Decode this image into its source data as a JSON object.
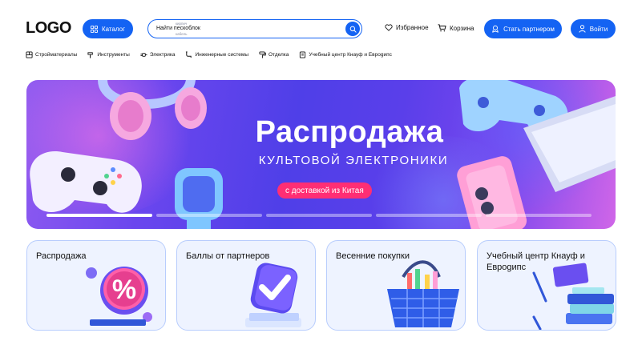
{
  "header": {
    "logo": "LOGO",
    "catalog_label": "Каталог",
    "search": {
      "value": "Найти пескоблок",
      "hint_top": "кирпич",
      "hint_bottom": "кабель"
    },
    "favorites_label": "Избранное",
    "cart_label": "Корзина",
    "partner_label": "Стать партнером",
    "login_label": "Войти"
  },
  "categories": [
    {
      "label": "Стройматериалы",
      "icon": "building-materials-icon"
    },
    {
      "label": "Инструменты",
      "icon": "hammer-icon"
    },
    {
      "label": "Электрика",
      "icon": "plug-icon"
    },
    {
      "label": "Инженерные системы",
      "icon": "pipe-icon"
    },
    {
      "label": "Отделка",
      "icon": "paint-roller-icon"
    },
    {
      "label": "Учебный центр Кнауф и Евроgипс",
      "icon": "book-icon"
    }
  ],
  "banner": {
    "title": "Распродажа",
    "subtitle": "КУЛЬТОВОЙ ЭЛЕКТРОНИКИ",
    "badge": "с доставкой из Китая",
    "slides_total": 5,
    "active_slide": 1
  },
  "cards": [
    {
      "title": "Распродажа"
    },
    {
      "title": "Баллы от партнеров"
    },
    {
      "title": "Весенние покупки"
    },
    {
      "title": "Учебный центр Кнауф и Евроgипс"
    }
  ],
  "colors": {
    "accent": "#1463f3",
    "badge": "#ff2e74",
    "card_bg": "#eef3ff",
    "card_border": "#b8cdfd"
  }
}
